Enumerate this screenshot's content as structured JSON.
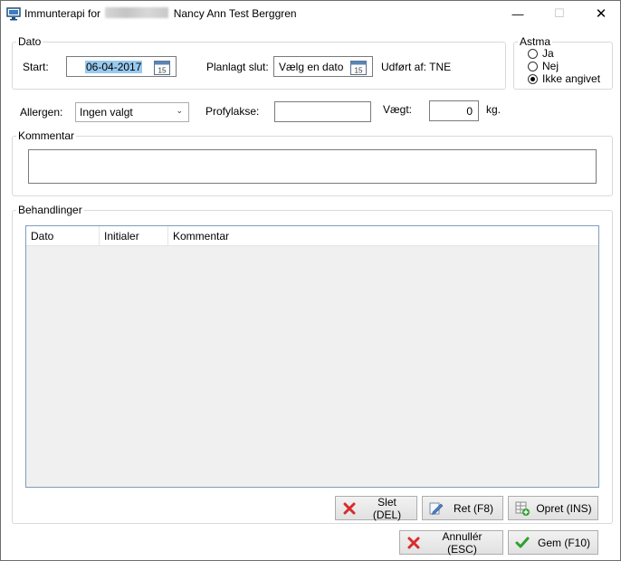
{
  "window": {
    "title_prefix": "Immunterapi for",
    "title_name": "Nancy Ann Test Berggren",
    "min": "—",
    "max": "☐",
    "close": "✕"
  },
  "dato": {
    "legend": "Dato",
    "start_label": "Start:",
    "start_value": "06-04-2017",
    "planned_label": "Planlagt slut:",
    "planned_value": "Vælg en dato",
    "performed_label": "Udført af: TNE"
  },
  "astma": {
    "legend": "Astma",
    "options": [
      "Ja",
      "Nej",
      "Ikke angivet"
    ],
    "selected": "Ikke angivet"
  },
  "row2": {
    "allergen_label": "Allergen:",
    "allergen_value": "Ingen valgt",
    "profylakse_label": "Profylakse:",
    "profylakse_value": "",
    "vaegt_label": "Vægt:",
    "vaegt_value": "0",
    "unit": "kg."
  },
  "kommentar": {
    "legend": "Kommentar",
    "value": ""
  },
  "behandlinger": {
    "legend": "Behandlinger",
    "columns": [
      "Dato",
      "Initialer",
      "Kommentar"
    ],
    "rows": []
  },
  "buttons": {
    "slet": "Slet (DEL)",
    "ret": "Ret (F8)",
    "opret": "Opret (INS)",
    "annuller": "Annullér (ESC)",
    "gem": "Gem (F10)"
  },
  "colors": {
    "selection": "#99c9ef",
    "delete_red": "#d92b2b",
    "save_green": "#2ea02e"
  }
}
